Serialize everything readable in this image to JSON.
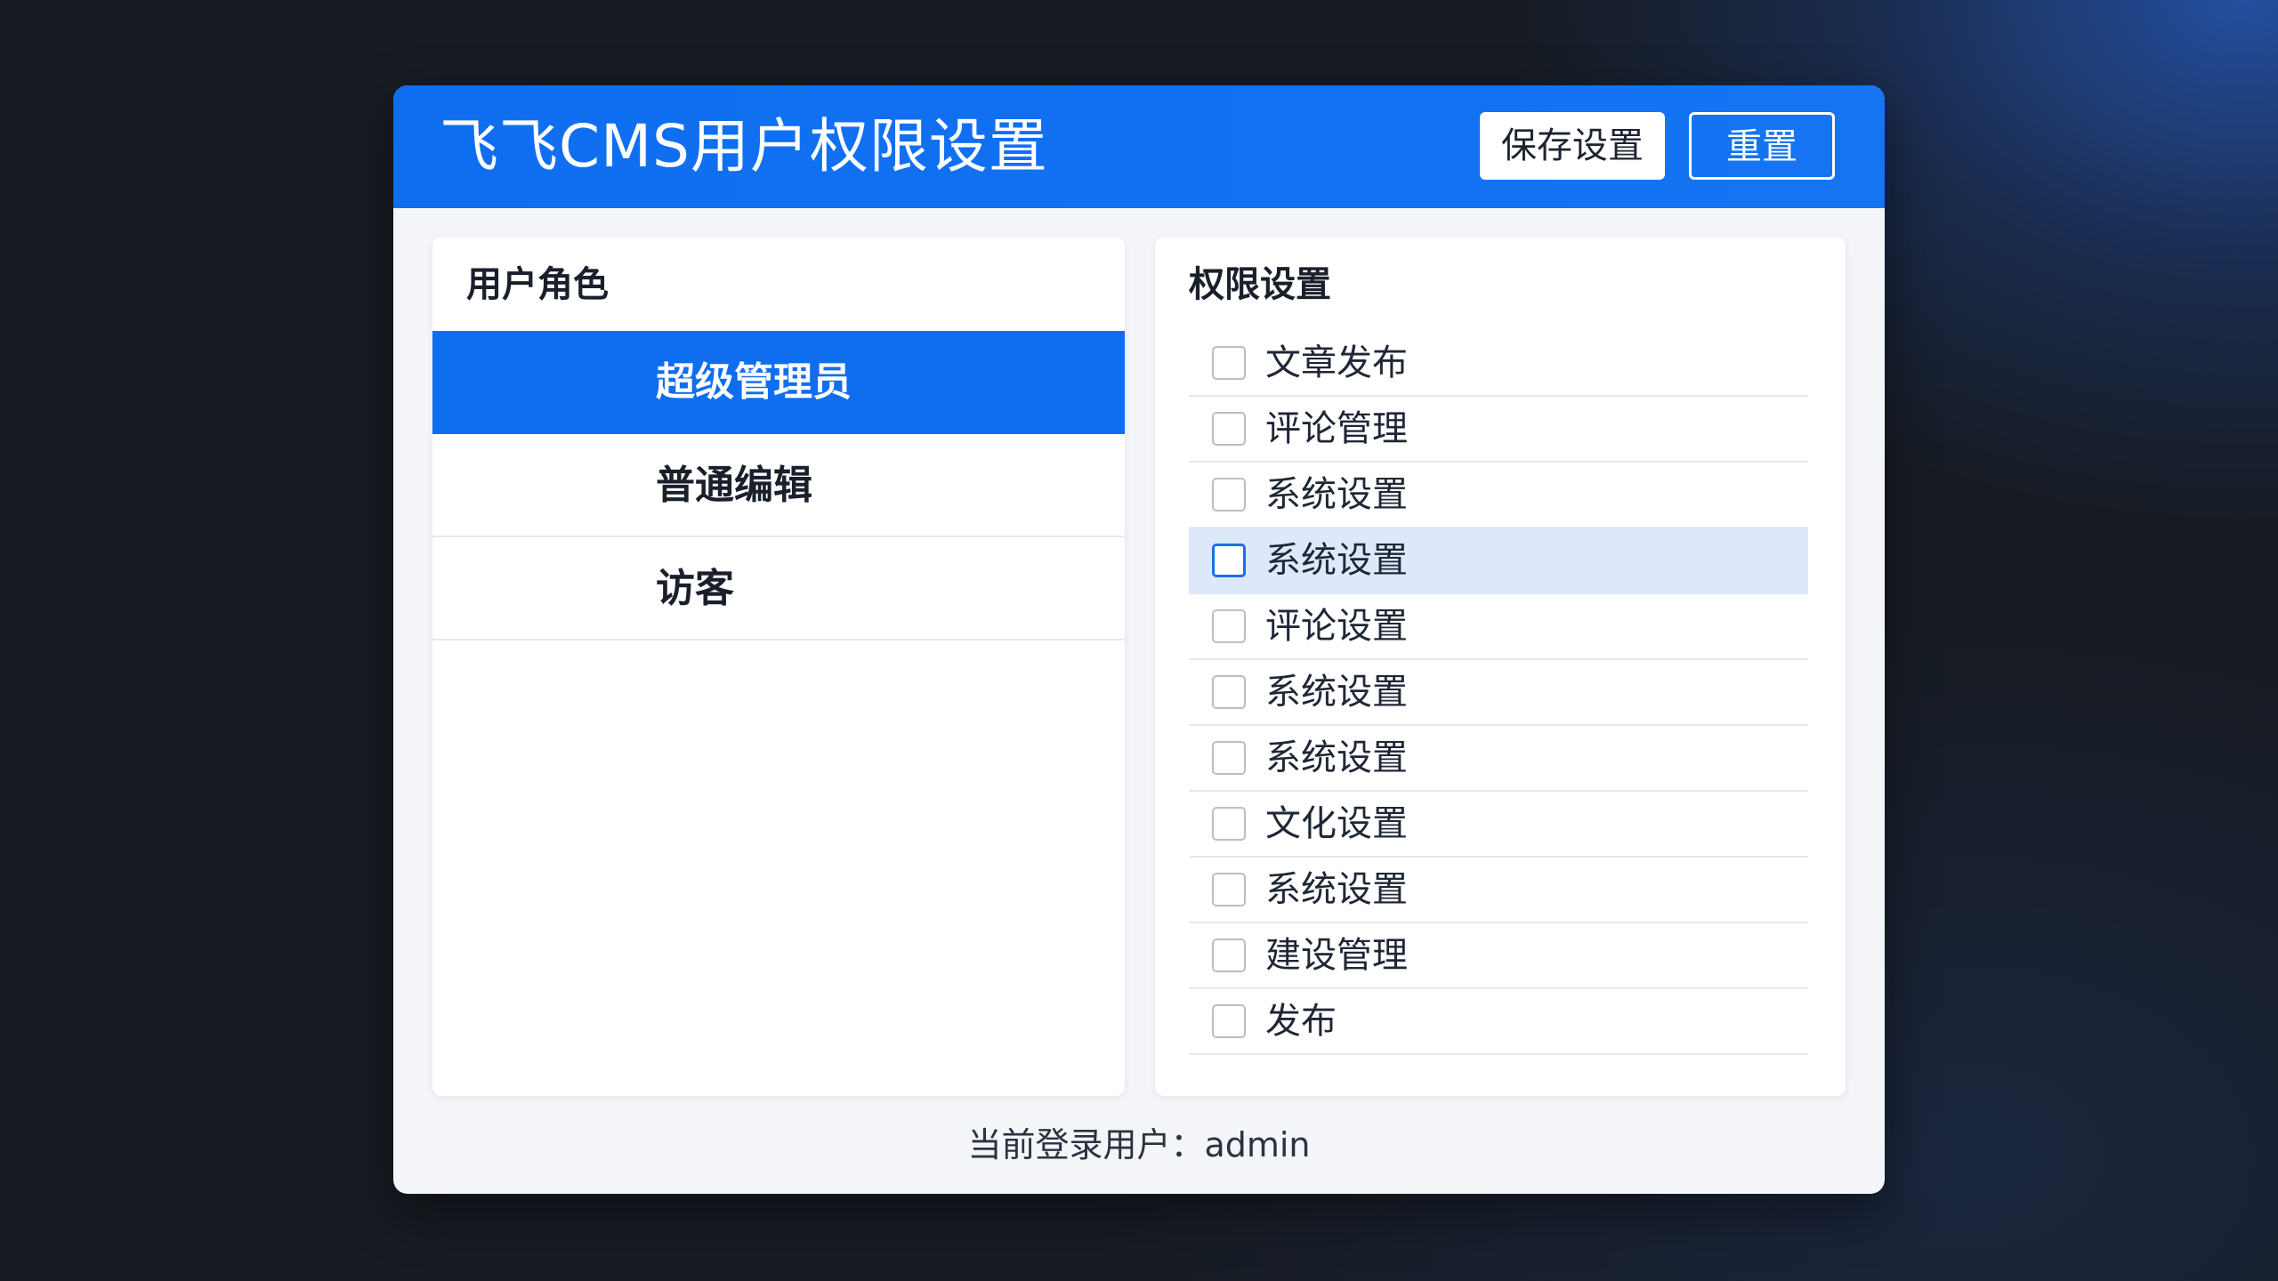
{
  "header": {
    "title": "飞飞CMS用户权限设置",
    "save_label": "保存设置",
    "reset_label": "重置"
  },
  "roles_panel": {
    "title": "用户角色",
    "items": [
      {
        "label": "超级管理员",
        "selected": true
      },
      {
        "label": "普通编辑",
        "selected": false
      },
      {
        "label": "访客",
        "selected": false
      }
    ]
  },
  "permissions_panel": {
    "title": "权限设置",
    "items": [
      {
        "label": "文章发布",
        "checked": false
      },
      {
        "label": "评论管理",
        "checked": false
      },
      {
        "label": "系统设置",
        "checked": false
      },
      {
        "label": "系统设置",
        "checked": false,
        "highlighted": true
      },
      {
        "label": "评论设置",
        "checked": false
      },
      {
        "label": "系统设置",
        "checked": false
      },
      {
        "label": "系统设置",
        "checked": false
      },
      {
        "label": "文化设置",
        "checked": false
      },
      {
        "label": "系统设置",
        "checked": false
      },
      {
        "label": "建设管理",
        "checked": false
      },
      {
        "label": "发布",
        "checked": false
      }
    ]
  },
  "footer": {
    "current_user_text": "当前登录用户：admin"
  },
  "colors": {
    "accent": "#0f6ef0",
    "highlight_row": "#dde9fb",
    "window_bg": "#f3f5f8",
    "page_bg": "#171b22"
  }
}
